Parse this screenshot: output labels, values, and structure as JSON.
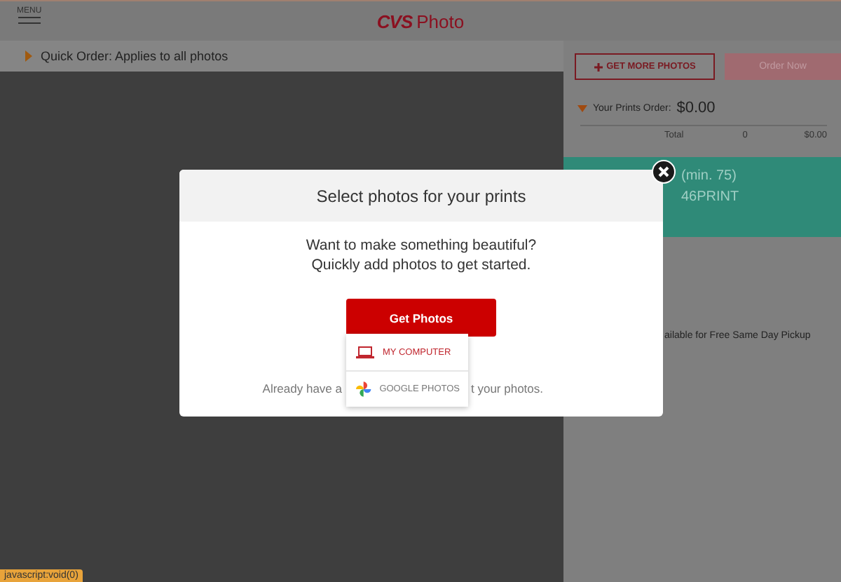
{
  "header": {
    "menu_label": "MENU",
    "logo_brand": "CVS",
    "logo_word": "Photo"
  },
  "quick_order": {
    "label": "Quick Order",
    "text": ": Applies to all photos"
  },
  "cart": {
    "get_more": "GET MORE PHOTOS",
    "order_now": "Order Now",
    "order_now_disabled": true,
    "summary_label": "Your Prints Order:",
    "summary_total": "$0.00",
    "total_label": "Total",
    "total_count": "0",
    "total_amount": "$0.00"
  },
  "promo": {
    "lines": [
      "(min. 75)",
      "46PRINT"
    ]
  },
  "pickup_note": "ailable for Free Same Day Pickup",
  "modal": {
    "title": "Select photos for your prints",
    "message": [
      "Want to make something beautiful?",
      "Quickly add photos to get started."
    ],
    "button": "Get Photos",
    "footer_left": "Already have a",
    "footer_right": "t your photos.",
    "sources": [
      {
        "kind": "computer",
        "label": "MY COMPUTER",
        "selected": true
      },
      {
        "kind": "google",
        "label": "GOOGLE PHOTOS",
        "selected": false
      }
    ]
  },
  "status_bar": "javascript:void(0)"
}
